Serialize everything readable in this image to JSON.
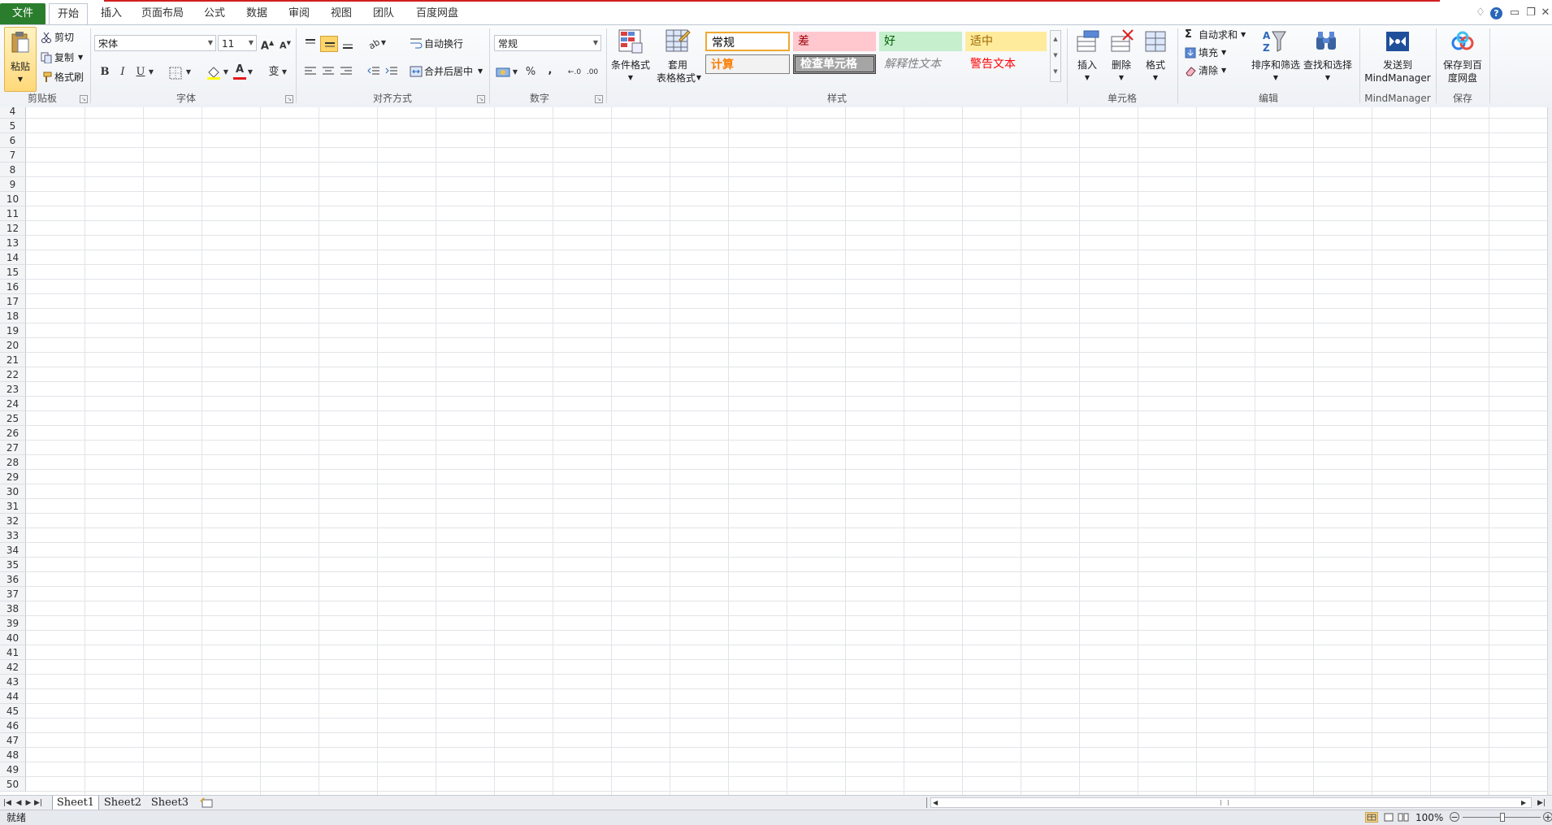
{
  "tabs": {
    "file": "文件",
    "home": "开始",
    "insert": "插入",
    "page_layout": "页面布局",
    "formulas": "公式",
    "data": "数据",
    "review": "审阅",
    "view": "视图",
    "team": "团队",
    "baidu": "百度网盘"
  },
  "clipboard": {
    "paste": "粘贴",
    "cut": "剪切",
    "copy": "复制",
    "format_painter": "格式刷",
    "label": "剪贴板"
  },
  "font": {
    "name": "宋体",
    "size": "11",
    "bold": "B",
    "italic": "I",
    "underline": "U",
    "pinyin": "wén",
    "label": "字体"
  },
  "alignment": {
    "wrap": "自动换行",
    "merge": "合并后居中",
    "label": "对齐方式"
  },
  "number": {
    "format": "常规",
    "percent": "%",
    "comma": ",",
    "label": "数字"
  },
  "styles": {
    "conditional": "条件格式",
    "table_format_1": "套用",
    "table_format_2": "表格格式",
    "normal": "常规",
    "bad": "差",
    "good": "好",
    "neutral": "适中",
    "calc": "计算",
    "check": "检查单元格",
    "explanatory": "解释性文本",
    "warning": "警告文本",
    "label": "样式"
  },
  "cells": {
    "insert": "插入",
    "delete": "删除",
    "format": "格式",
    "label": "单元格"
  },
  "editing": {
    "autosum": "自动求和",
    "fill": "填充",
    "clear": "清除",
    "sort": "排序和筛选",
    "find": "查找和选择",
    "label": "编辑"
  },
  "mindmanager": {
    "send_1": "发送到",
    "send_2": "MindManager",
    "label": "MindManager"
  },
  "save": {
    "save_1": "保存到百",
    "save_2": "度网盘",
    "label": "保存"
  },
  "rows": [
    "4",
    "5",
    "6",
    "7",
    "8",
    "9",
    "10",
    "11",
    "12",
    "13",
    "14",
    "15",
    "16",
    "17",
    "18",
    "19",
    "20",
    "21",
    "22",
    "23",
    "24",
    "25",
    "26",
    "27",
    "28",
    "29",
    "30",
    "31",
    "32",
    "33",
    "34",
    "35",
    "36",
    "37",
    "38",
    "39",
    "40",
    "41",
    "42",
    "43",
    "44",
    "45",
    "46",
    "47",
    "48",
    "49",
    "50"
  ],
  "sheets": [
    "Sheet1",
    "Sheet2",
    "Sheet3"
  ],
  "status": {
    "ready": "就绪",
    "zoom": "100%"
  },
  "colors": {
    "file_tab": "#2b7d2e",
    "accent_line": "#d21f1f",
    "grid_line": "#e1e4e8"
  }
}
